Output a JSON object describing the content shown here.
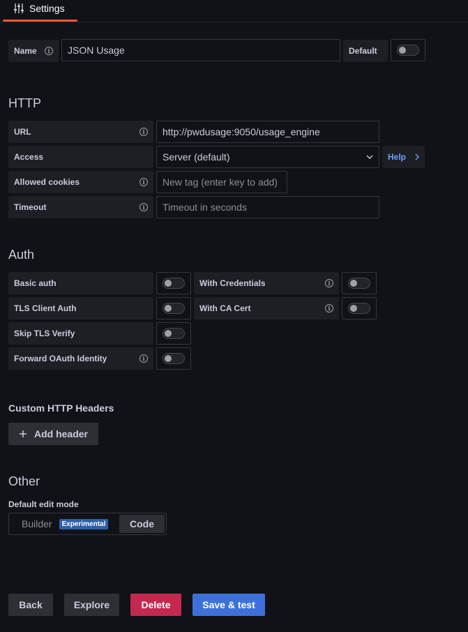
{
  "tabs": [
    {
      "label": "Settings",
      "icon": "sliders-icon",
      "active": true
    }
  ],
  "name_row": {
    "label": "Name",
    "value": "JSON Usage",
    "default_label": "Default",
    "default_on": false
  },
  "http": {
    "title": "HTTP",
    "url_label": "URL",
    "url_value": "http://pwdusage:9050/usage_engine",
    "access_label": "Access",
    "access_value": "Server (default)",
    "help_label": "Help",
    "cookies_label": "Allowed cookies",
    "cookies_placeholder": "New tag (enter key to add)",
    "timeout_label": "Timeout",
    "timeout_placeholder": "Timeout in seconds"
  },
  "auth": {
    "title": "Auth",
    "basic_auth": "Basic auth",
    "with_credentials": "With Credentials",
    "tls_client_auth": "TLS Client Auth",
    "with_ca_cert": "With CA Cert",
    "skip_tls_verify": "Skip TLS Verify",
    "forward_oauth": "Forward OAuth Identity"
  },
  "headers": {
    "title": "Custom HTTP Headers",
    "add_label": "Add header"
  },
  "other": {
    "title": "Other",
    "edit_mode_label": "Default edit mode",
    "builder_label": "Builder",
    "badge": "Experimental",
    "code_label": "Code",
    "selected": "Code"
  },
  "footer": {
    "back": "Back",
    "explore": "Explore",
    "delete": "Delete",
    "save_test": "Save & test"
  },
  "colors": {
    "background": "#111217",
    "accent_tab": "#f05a28",
    "primary": "#3d71d9",
    "danger": "#c4284f",
    "link": "#6e9fff"
  }
}
